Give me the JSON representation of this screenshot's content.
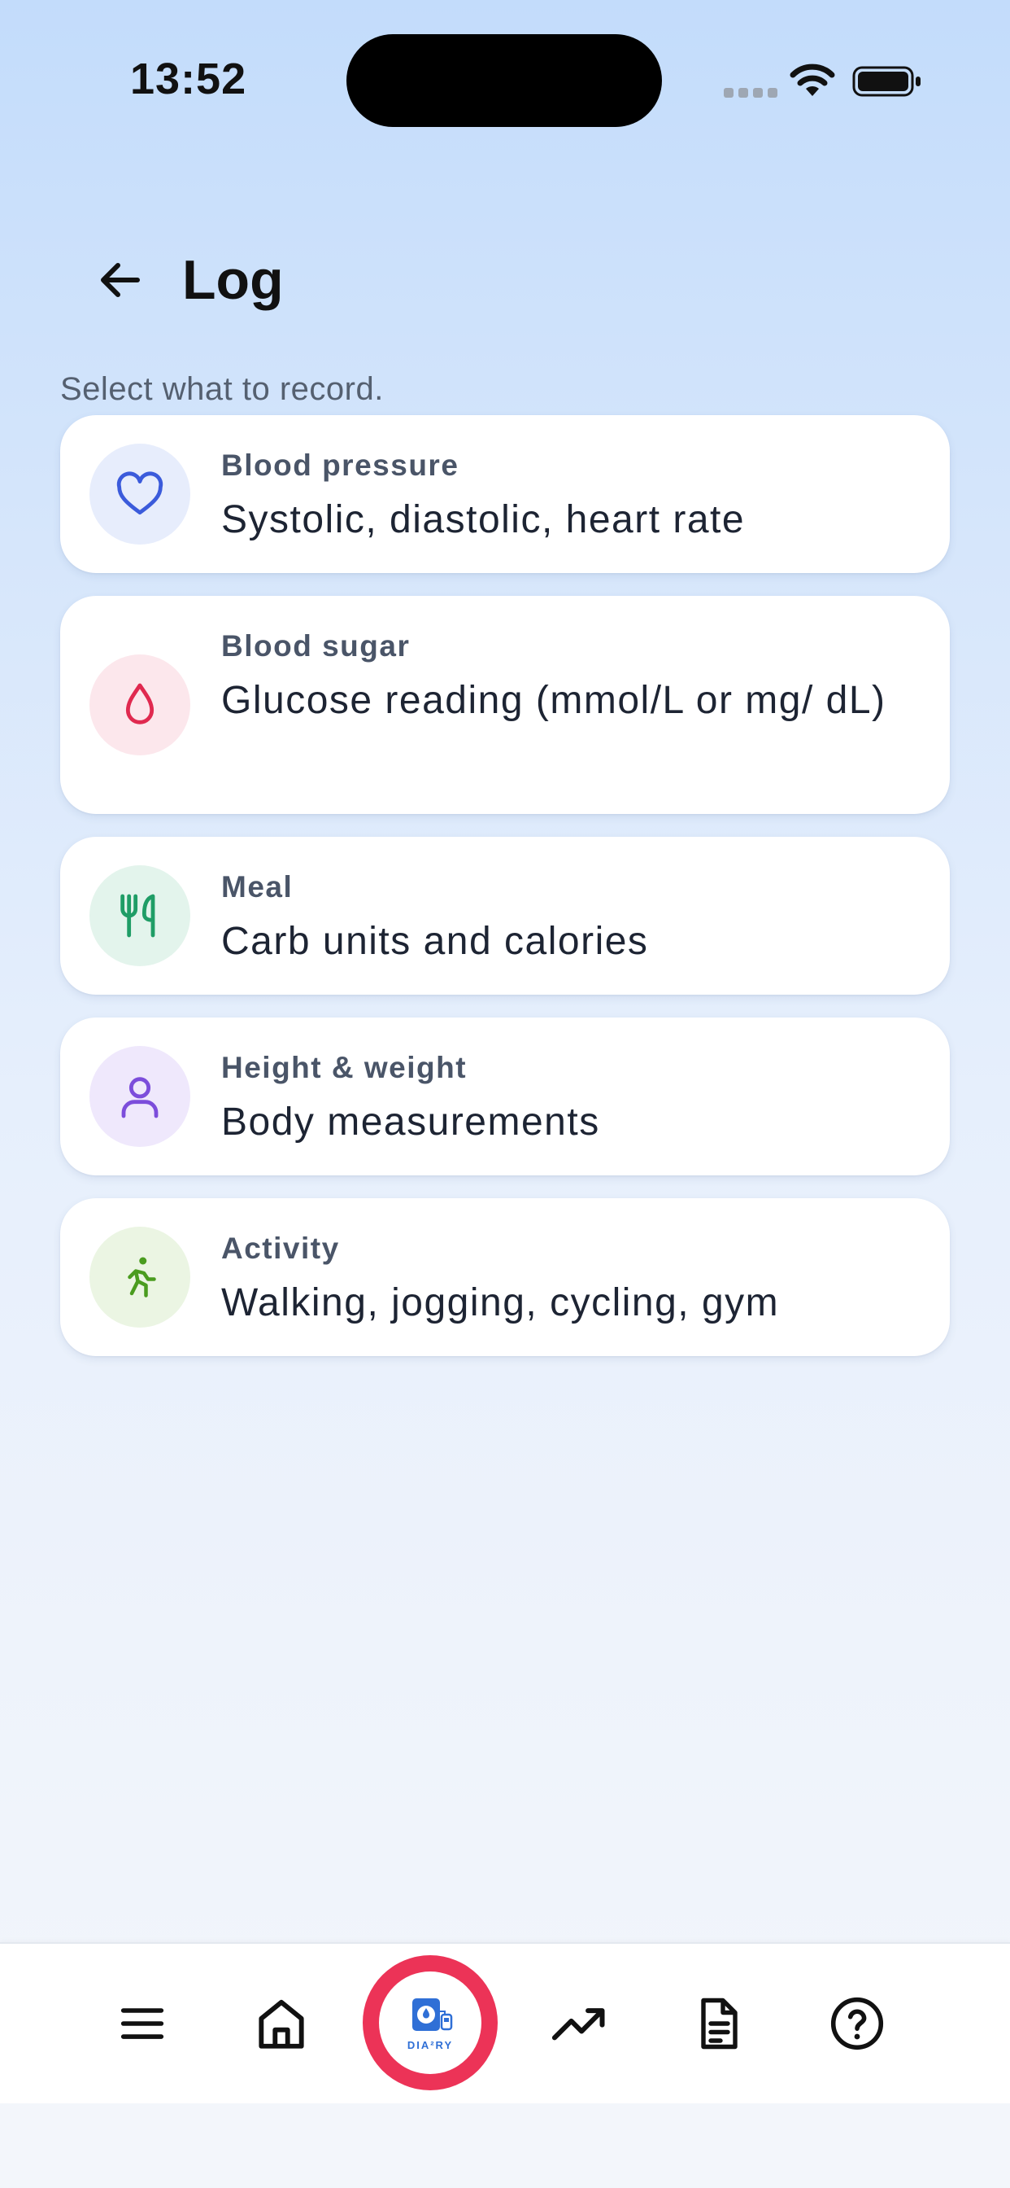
{
  "status_bar": {
    "time": "13:52"
  },
  "header": {
    "title": "Log",
    "back_icon": "arrow-left-icon"
  },
  "subtitle": "Select what to record.",
  "entries": [
    {
      "label": "Blood pressure",
      "description": "Systolic, diastolic, heart rate",
      "icon": "heart-icon",
      "icon_color": "#3b5bdb",
      "icon_bg": "#e7edfc"
    },
    {
      "label": "Blood sugar",
      "description": "Glucose reading (mmol/L or mg/ dL)",
      "icon": "drop-icon",
      "icon_color": "#e0294f",
      "icon_bg": "#fce7ec"
    },
    {
      "label": "Meal",
      "description": "Carb units and calories",
      "icon": "utensils-icon",
      "icon_color": "#1f9d66",
      "icon_bg": "#e3f4ec"
    },
    {
      "label": "Height & weight",
      "description": "Body measurements",
      "icon": "person-icon",
      "icon_color": "#7c4ddb",
      "icon_bg": "#efe8fc"
    },
    {
      "label": "Activity",
      "description": "Walking, jogging, cycling, gym",
      "icon": "runner-icon",
      "icon_color": "#4a9c1f",
      "icon_bg": "#ebf5e3"
    }
  ],
  "bottom_nav": {
    "items": [
      "menu-icon",
      "home-icon",
      "diary-logo",
      "trending-icon",
      "document-icon",
      "help-icon"
    ],
    "logo_text": "DIA²RY",
    "accent": "#ec3357"
  }
}
